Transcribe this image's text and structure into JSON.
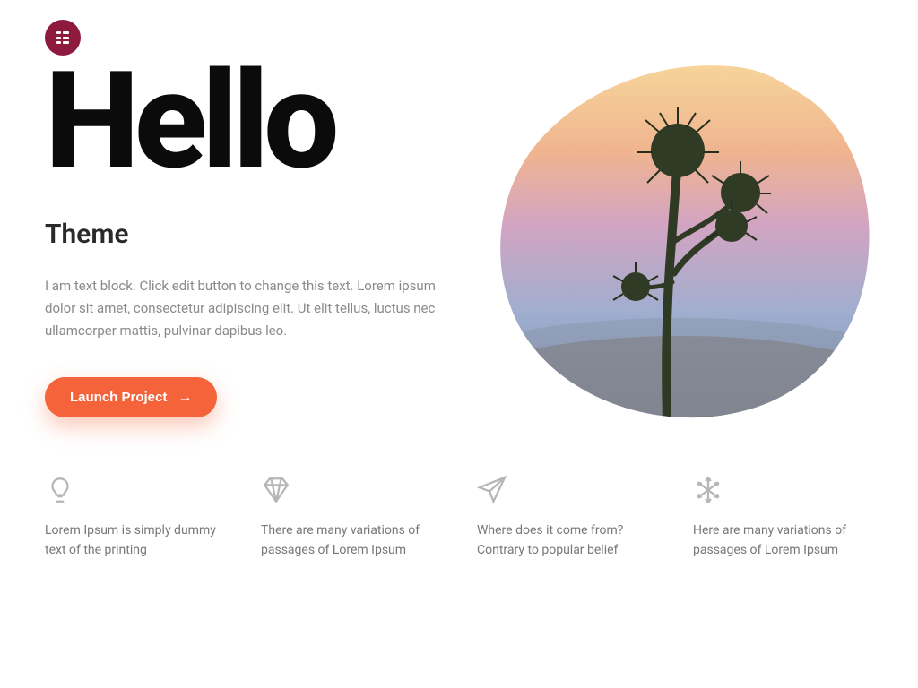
{
  "logo_icon": "elementor",
  "hero": {
    "title": "Hello",
    "subtitle": "Theme",
    "description": "I am text block. Click edit button to change this text. Lorem ipsum dolor sit amet, consectetur adipiscing elit. Ut elit tellus, luctus nec ullamcorper mattis, pulvinar dapibus leo.",
    "cta_label": "Launch Project",
    "cta_color": "#f4633a",
    "image_alt": "thorny desert plant against sunset sky"
  },
  "features": [
    {
      "icon": "lightbulb-icon",
      "text": "Lorem Ipsum is simply dummy text of the printing"
    },
    {
      "icon": "diamond-icon",
      "text": "There are many variations of passages of Lorem Ipsum"
    },
    {
      "icon": "paper-plane-icon",
      "text": "Where does it come from? Contrary to popular belief"
    },
    {
      "icon": "snowflake-icon",
      "text": "Here are many variations of passages of Lorem Ipsum"
    }
  ]
}
